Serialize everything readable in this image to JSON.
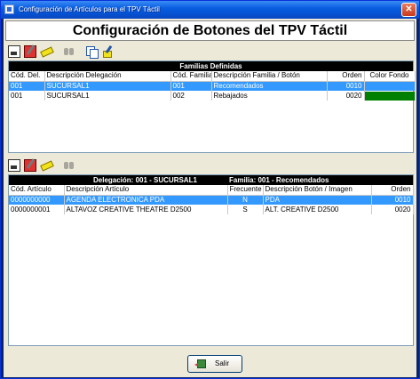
{
  "window": {
    "title": "Configuración de Artículos para el TPV Táctil",
    "close_glyph": "✕"
  },
  "header": {
    "title": "Configuración de Botones del TPV Táctil"
  },
  "toolbar1": {
    "icons": [
      "new-icon",
      "edit-icon",
      "erase-icon",
      "find-icon",
      "copy-icon",
      "paint-icon"
    ]
  },
  "toolbar2": {
    "icons": [
      "new-icon",
      "edit-icon",
      "erase-icon",
      "find-icon"
    ]
  },
  "families": {
    "caption": "Familias Definidas",
    "columns": [
      "Cód. Del.",
      "Descripción Delegación",
      "Cód. Familia",
      "Descripción Familia / Botón",
      "Orden",
      "Color Fondo"
    ],
    "rows": [
      {
        "cod_del": "001",
        "delegacion": "SUCURSAL1",
        "cod_familia": "001",
        "descripcion": "Recomendados",
        "orden": "0010",
        "color": "",
        "selected": true
      },
      {
        "cod_del": "001",
        "delegacion": "SUCURSAL1",
        "cod_familia": "002",
        "descripcion": "Rebajados",
        "orden": "0020",
        "color": "#008000",
        "selected": false
      }
    ]
  },
  "articles": {
    "caption_delegation": "Delegación: 001 - SUCURSAL1",
    "caption_family": "Familia: 001 - Recomendados",
    "columns": [
      "Cód. Artículo",
      "Descripción Artículo",
      "Frecuente",
      "Descripción Botón / Imagen",
      "Orden"
    ],
    "rows": [
      {
        "cod": "0000000000",
        "descripcion": "AGENDA ELECTRONICA PDA",
        "frecuente": "N",
        "boton": "PDA",
        "orden": "0010",
        "selected": true
      },
      {
        "cod": "0000000001",
        "descripcion": "ALTAVOZ CREATIVE THEATRE D2500",
        "frecuente": "S",
        "boton": "ALT. CREATIVE D2500",
        "orden": "0020",
        "selected": false
      }
    ]
  },
  "footer": {
    "exit_label": "Salir"
  },
  "colors": {
    "selection": "#3399ff",
    "grid_header": "#000000",
    "titlebar": "#0553d4"
  }
}
